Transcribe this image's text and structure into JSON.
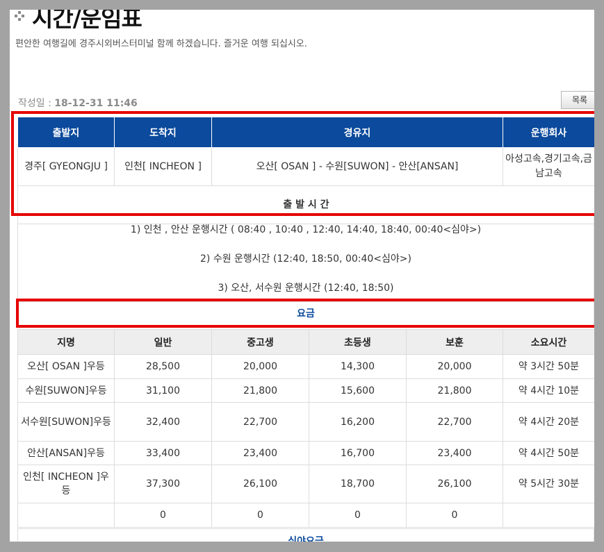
{
  "header": {
    "title": "시간/운임표",
    "subtitle": "편안한 여행길에 경주시외버스터미널 함께 하겠습니다. 즐거운 여행 되십시오.",
    "icon": "diamond-dots-icon"
  },
  "post": {
    "date_label": "작성일 : ",
    "date_value": "18-12-31 11:46",
    "list_button": "목록"
  },
  "route": {
    "headers": [
      "출발지",
      "도착지",
      "경유지",
      "운행회사"
    ],
    "row": [
      "경주[ GYEONGJU ]",
      "인천[ INCHEON ]",
      "오산[ OSAN ] - 수원[SUWON] - 안산[ANSAN]",
      "아성고속,경기고속,금남고속"
    ]
  },
  "schedule": {
    "heading": "출 발 시 간",
    "lines": [
      "1) 인천 , 안산 운행시간 ( 08:40 , 10:40 , 12:40, 14:40, 18:40, 00:40<심야>)",
      "2) 수원 운행시간 (12:40, 18:50, 00:40<심야>)",
      "3) 오산, 서수원 운행시간 (12:40, 18:50)"
    ]
  },
  "fares": {
    "heading": "요금",
    "headers": [
      "지명",
      "일반",
      "중고생",
      "초등생",
      "보훈",
      "소요시간"
    ],
    "rows": [
      [
        "오산[ OSAN ]우등",
        "28,500",
        "20,000",
        "14,300",
        "20,000",
        "약 3시간 50분"
      ],
      [
        "수원[SUWON]우등",
        "31,100",
        "21,800",
        "15,600",
        "21,800",
        "약 4시간 10분"
      ],
      [
        "서수원[SUWON]우등",
        "32,400",
        "22,700",
        "16,200",
        "22,700",
        "약 4시간 20분"
      ],
      [
        "안산[ANSAN]우등",
        "33,400",
        "23,400",
        "16,700",
        "23,400",
        "약 4시간 50분"
      ],
      [
        "인천[ INCHEON ]우등",
        "37,300",
        "26,100",
        "18,700",
        "26,100",
        "약 5시간 30분"
      ],
      [
        "",
        "0",
        "0",
        "0",
        "0",
        ""
      ]
    ],
    "night_heading": "심야요금"
  },
  "colors": {
    "header_blue": "#0b4a9c",
    "highlight_red": "#e60000",
    "backdrop": "#a3a3a3"
  }
}
